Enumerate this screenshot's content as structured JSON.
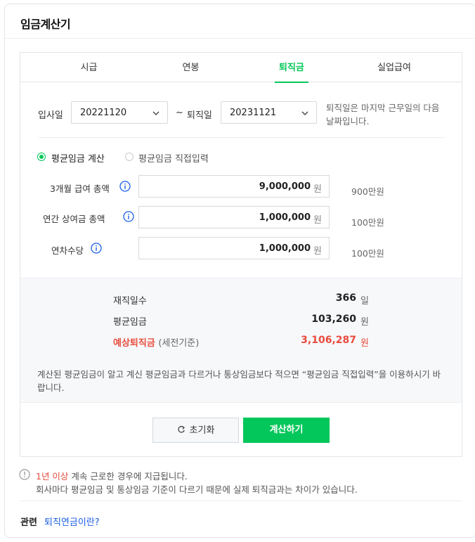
{
  "title": "임금계산기",
  "tabs": [
    {
      "label": "시급",
      "active": false
    },
    {
      "label": "연봉",
      "active": false
    },
    {
      "label": "퇴직금",
      "active": true
    },
    {
      "label": "실업급여",
      "active": false
    }
  ],
  "dates": {
    "start_label": "입사일",
    "start_value": "20221120",
    "tilde": "~",
    "end_label": "퇴직일",
    "end_value": "20231121",
    "note": "퇴직일은 마지막 근무일의 다음 날짜입니다."
  },
  "mode": {
    "option1": "평균임금 계산",
    "option2": "평균임금 직접입력",
    "selected": "평균임금 계산"
  },
  "inputs": [
    {
      "label": "3개월 급여 총액",
      "value": "9,000,000",
      "unit": "원",
      "hint": "900만원"
    },
    {
      "label": "연간 상여금 총액",
      "value": "1,000,000",
      "unit": "원",
      "hint": "100만원"
    },
    {
      "label": "연차수당",
      "value": "1,000,000",
      "unit": "원",
      "hint": "100만원"
    }
  ],
  "results": {
    "days_label": "재직일수",
    "days_value": "366",
    "days_unit": "일",
    "avg_label": "평균임금",
    "avg_value": "103,260",
    "avg_unit": "원",
    "severance_label": "예상퇴직금",
    "severance_sub": "(세전기준)",
    "severance_value": "3,106,287",
    "severance_unit": "원",
    "description": "계산된 평균임금이 알고 계신 평균임금과 다르거나 통상임금보다 적으면 “평균임금 직접입력”을 이용하시기 바랍니다."
  },
  "buttons": {
    "reset": "초기화",
    "calculate": "계산하기"
  },
  "footer": {
    "highlight": "1년 이상",
    "line1_rest": " 계속 근로한 경우에 지급됩니다.",
    "line2": "회사마다 평균임금 및 통상임금 기준이 다르기 때문에 실제 퇴직금과는 차이가 있습니다.",
    "related_label": "관련",
    "related_link": "퇴직연금이란?"
  },
  "colors": {
    "accent": "#03c75a",
    "danger": "#e84c3d",
    "link": "#1a5ee6"
  },
  "icons": [
    "chevron-down-icon",
    "info-icon",
    "reset-icon",
    "warning-circle-icon"
  ]
}
